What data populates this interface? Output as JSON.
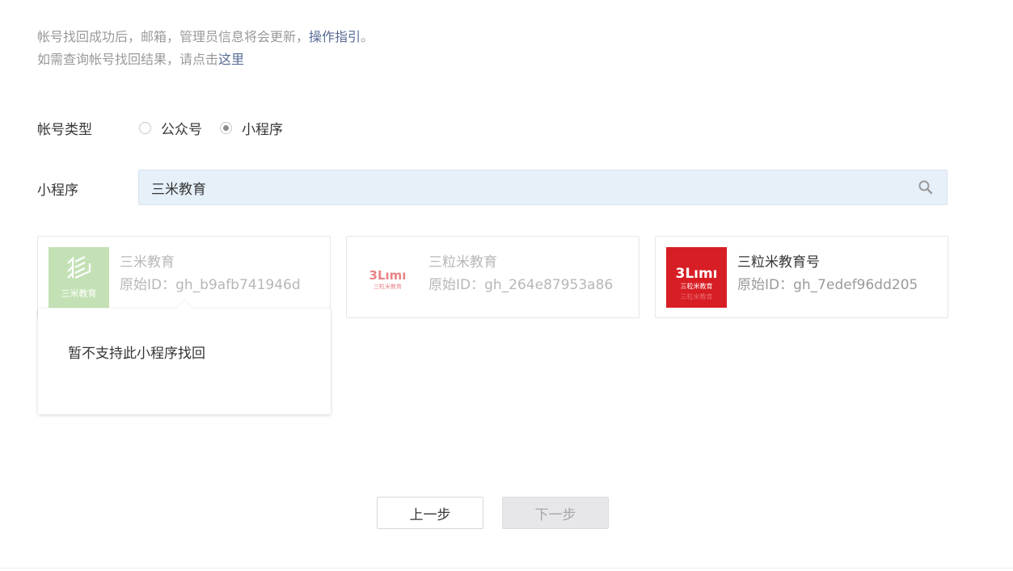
{
  "notice": {
    "line1_text": "帐号找回成功后，邮箱，管理员信息将会更新，",
    "line1_link": "操作指引",
    "line1_end": "。",
    "line2_text": "如需查询帐号找回结果，请点击",
    "line2_link": "这里"
  },
  "account_type": {
    "label": "帐号类型",
    "options": [
      {
        "label": "公众号",
        "checked": false
      },
      {
        "label": "小程序",
        "checked": true
      }
    ]
  },
  "search": {
    "label": "小程序",
    "value": "三米教育",
    "icon": "search-icon"
  },
  "results": [
    {
      "name": "三米教育",
      "origin_id": "原始ID：gh_b9afb741946d",
      "enabled": false,
      "logo_text": "三米教育",
      "logo_bg": "#93c979"
    },
    {
      "name": "三粒米教育",
      "origin_id": "原始ID：gh_264e87953a86",
      "enabled": false,
      "logo_text": "三粒米教育",
      "logo_bg": "#ffffff"
    },
    {
      "name": "三粒米教育号",
      "origin_id": "原始ID：gh_7edef96dd205",
      "enabled": true,
      "logo_text": "三粒米教育",
      "logo_bg": "#d81e25"
    }
  ],
  "tooltip": {
    "message": "暂不支持此小程序找回"
  },
  "buttons": {
    "prev": "上一步",
    "next": "下一步"
  },
  "colors": {
    "link": "#576b95",
    "search_bg": "#e6f0f8",
    "disabled_btn_bg": "#e7e7eb"
  }
}
